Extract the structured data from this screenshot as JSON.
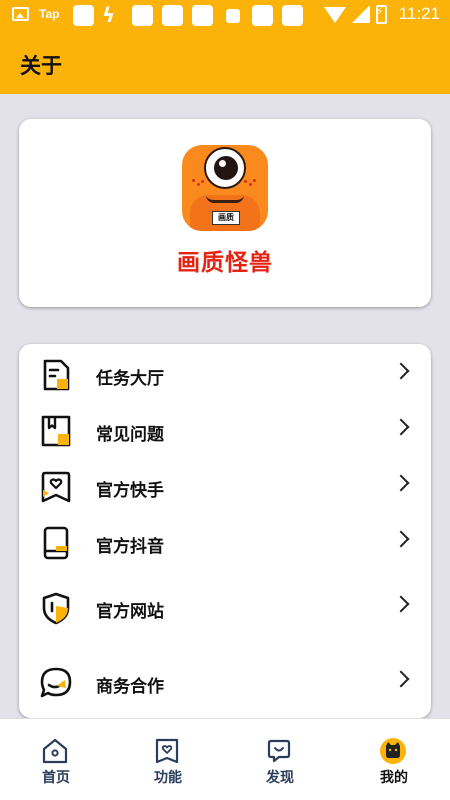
{
  "status_bar": {
    "app_indicator": "Tap",
    "time": "11:21",
    "icons": [
      "image-icon",
      "square-icon",
      "bolt-icon",
      "square-icon",
      "square-icon",
      "square-icon",
      "square-icon",
      "square-icon",
      "square-icon",
      "wifi-icon",
      "signal-icon",
      "battery-charging-icon"
    ]
  },
  "header": {
    "title": "关于"
  },
  "about": {
    "logo_badge": "画质",
    "app_name": "画质怪兽"
  },
  "menu": {
    "items": [
      {
        "label": "任务大厅",
        "icon": "task-doc-icon"
      },
      {
        "label": "常见问题",
        "icon": "faq-book-icon"
      },
      {
        "label": "官方快手",
        "icon": "kuaishou-heart-icon"
      },
      {
        "label": "官方抖音",
        "icon": "phone-icon"
      },
      {
        "label": "官方网站",
        "icon": "shield-icon"
      },
      {
        "label": "商务合作",
        "icon": "chat-bubble-icon"
      }
    ]
  },
  "bottom_nav": {
    "items": [
      {
        "label": "首页",
        "icon": "home-icon",
        "active": false
      },
      {
        "label": "功能",
        "icon": "heart-card-icon",
        "active": false
      },
      {
        "label": "发现",
        "icon": "discover-icon",
        "active": false
      },
      {
        "label": "我的",
        "icon": "cat-avatar-icon",
        "active": true
      }
    ]
  },
  "colors": {
    "brand": "#fbb30a",
    "app_name": "#e52312",
    "background": "#e3e1ea"
  }
}
